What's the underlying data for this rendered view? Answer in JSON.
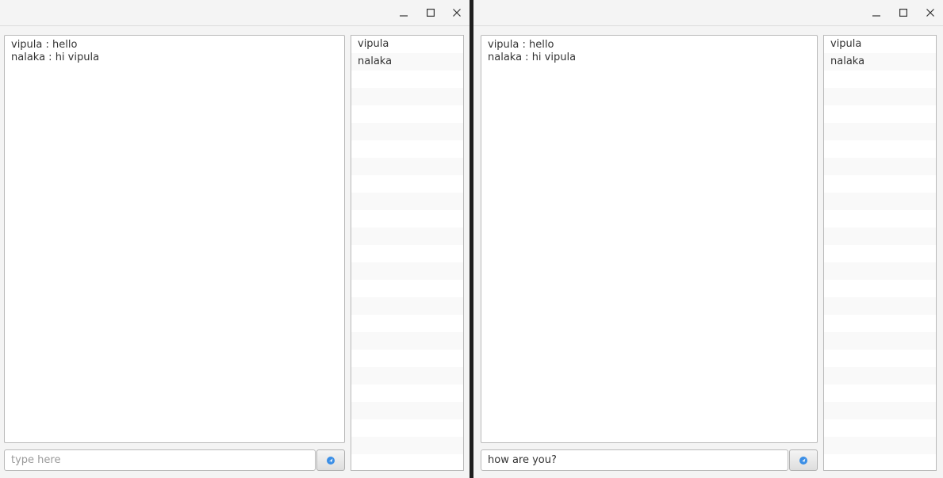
{
  "windows": [
    {
      "chat_lines": [
        "vipula : hello",
        "nalaka : hi vipula"
      ],
      "users": [
        "vipula",
        "nalaka"
      ],
      "input_value": "",
      "input_placeholder": "type here"
    },
    {
      "chat_lines": [
        "vipula : hello",
        "nalaka : hi vipula"
      ],
      "users": [
        "vipula",
        "nalaka"
      ],
      "input_value": "how are you?",
      "input_placeholder": ""
    }
  ],
  "icons": {
    "minimize": "minimize-icon",
    "maximize": "maximize-icon",
    "close": "close-icon",
    "send": "send-icon"
  },
  "colors": {
    "send_icon_blue": "#3a8ee6",
    "window_bg": "#f4f4f4",
    "list_stripe": "#f9f9f9"
  }
}
